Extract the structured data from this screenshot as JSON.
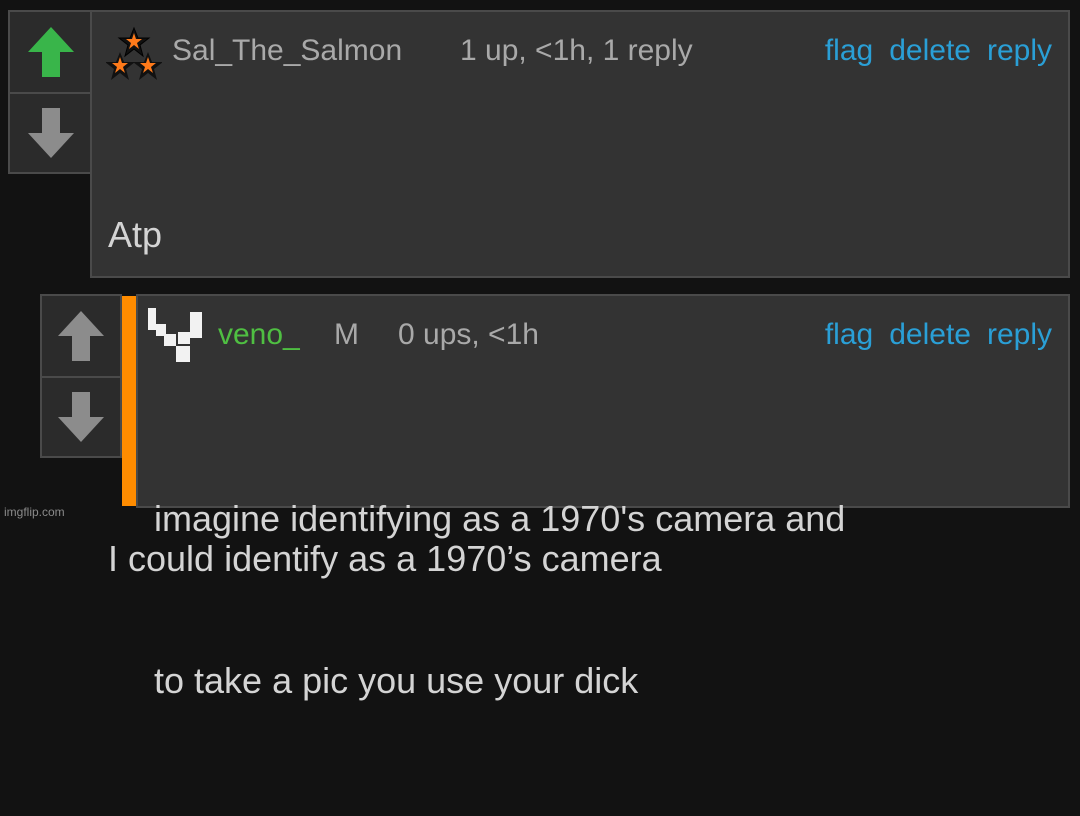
{
  "comments": [
    {
      "username": "Sal_The_Salmon",
      "meta": "1 up, <1h, 1 reply",
      "actions": {
        "flag": "flag",
        "delete": "delete",
        "reply": "reply"
      },
      "lines": [
        "Atp",
        "",
        "I could identify as a 1970’s camera"
      ],
      "upvote_icon": "up-arrow-icon",
      "downvote_icon": "down-arrow-icon",
      "upvote_active_color": "#39b54a"
    },
    {
      "username": "veno_",
      "badge": "M",
      "meta": "0 ups, <1h",
      "actions": {
        "flag": "flag",
        "delete": "delete",
        "reply": "reply"
      },
      "lines": [
        "imagine identifying as a 1970's camera and",
        "to take a pic you use your dick"
      ],
      "username_color": "#4fbf42",
      "accent_color": "#ff8c00"
    }
  ],
  "colors": {
    "link": "#2a9fd6",
    "panel": "#333333",
    "border": "#4a4a4a",
    "icon": "#8c8c8c"
  },
  "watermark": "imgflip.com"
}
